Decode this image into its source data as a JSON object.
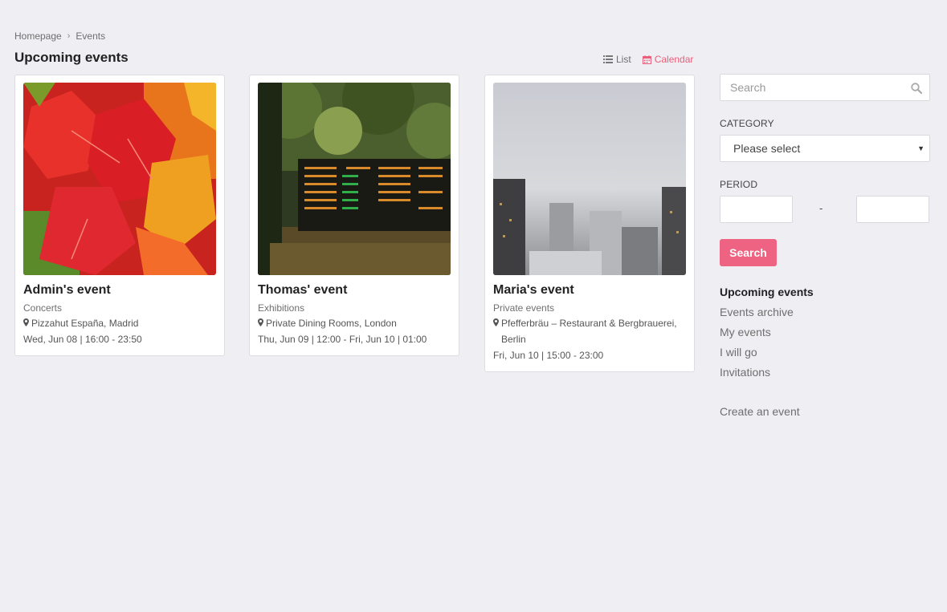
{
  "breadcrumb": {
    "home": "Homepage",
    "current": "Events"
  },
  "page_title": "Upcoming events",
  "view_switch": {
    "list_label": "List",
    "calendar_label": "Calendar"
  },
  "events": [
    {
      "title": "Admin's event",
      "category": "Concerts",
      "location": "Pizzahut España, Madrid",
      "date": "Wed, Jun 08 | 16:00 - 23:50"
    },
    {
      "title": "Thomas' event",
      "category": "Exhibitions",
      "location": "Private Dining Rooms, London",
      "date": "Thu, Jun 09 | 12:00 - Fri, Jun 10 | 01:00"
    },
    {
      "title": "Maria's event",
      "category": "Private events",
      "location": "Pfefferbräu – Restaurant & Bergbrauerei, Berlin",
      "date": "Fri, Jun 10 | 15:00 - 23:00"
    }
  ],
  "sidebar": {
    "search_placeholder": "Search",
    "category_label": "CATEGORY",
    "category_value": "Please select",
    "period_label": "PERIOD",
    "period_separator": "-",
    "search_button": "Search",
    "nav": [
      {
        "label": "Upcoming events"
      },
      {
        "label": "Events archive"
      },
      {
        "label": "My events"
      },
      {
        "label": "I will go"
      },
      {
        "label": "Invitations"
      }
    ],
    "create_label": "Create an event"
  },
  "colors": {
    "accent": "#ee6381",
    "calendar_link": "#e8607b",
    "background": "#eeeef3"
  },
  "icons": [
    "chevron-right-icon",
    "list-icon",
    "calendar-icon",
    "search-icon",
    "map-pin-icon",
    "caret-down-icon"
  ]
}
